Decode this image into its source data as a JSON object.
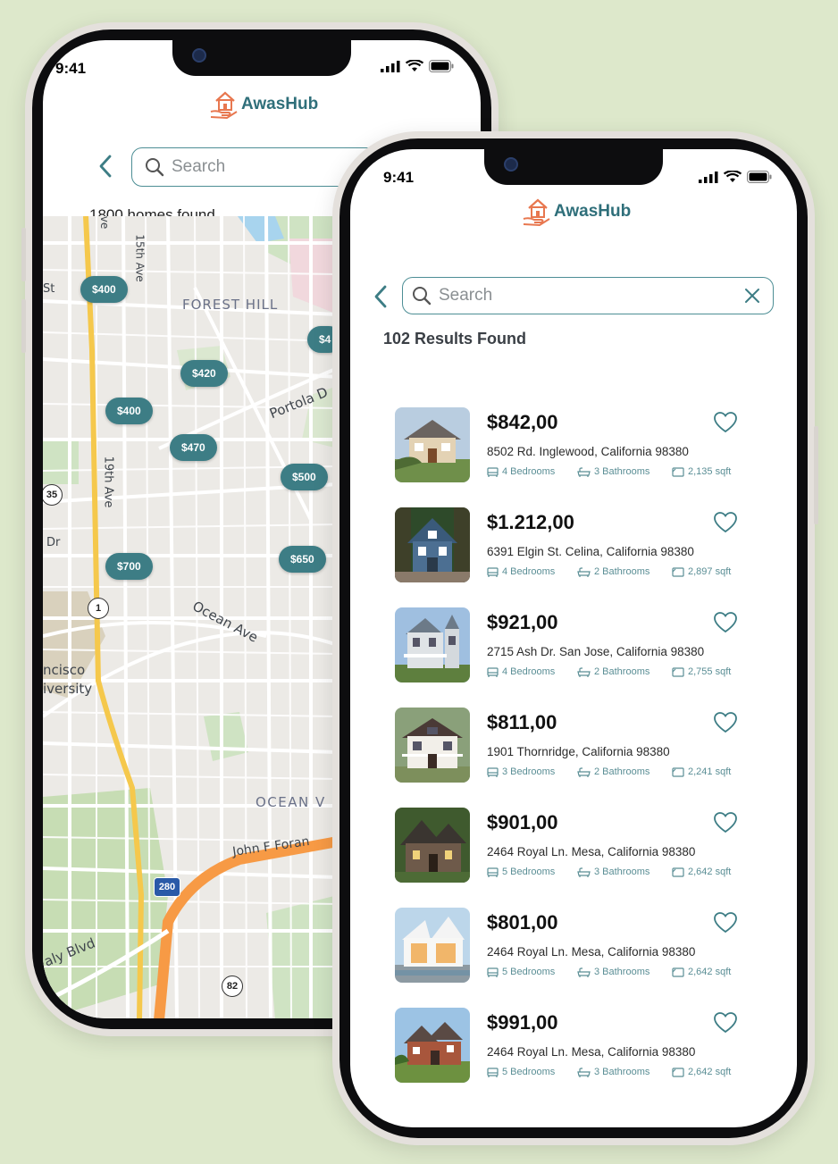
{
  "status": {
    "time": "9:41"
  },
  "brand": {
    "name": "AwasHub",
    "accent": "#e8774f",
    "primary": "#2f6f7a"
  },
  "map_screen": {
    "search_placeholder": "Search",
    "homes_found": "1800 homes found",
    "pins": [
      "$400",
      "$420",
      "$400",
      "$470",
      "$500",
      "$700",
      "$650",
      "$4"
    ],
    "labels": {
      "forest_hill": "FOREST HILL",
      "portola": "Portola D",
      "fifteenth_ave": "15th Ave",
      "nineteenth_ave": "19th Ave",
      "ocean_ave": "Ocean Ave",
      "ocean_v": "OCEAN V",
      "john_f_foran": "John F Foran",
      "francisco": "ncisco",
      "university": "iversity",
      "daly_blvd": "aly Blvd",
      "st": "St",
      "dr": "Dr",
      "ve": "ve"
    },
    "shields": [
      "35",
      "1",
      "280",
      "82"
    ]
  },
  "list_screen": {
    "search_placeholder": "Search",
    "results_found": "102 Results Found",
    "listings": [
      {
        "price": "$842,00",
        "address": "8502 Rd. Inglewood, California 98380",
        "bedrooms": "4 Bedrooms",
        "bathrooms": "3 Bathrooms",
        "area": "2,135 sqft",
        "image": "house-craftsman"
      },
      {
        "price": "$1.212,00",
        "address": "6391 Elgin St. Celina, California 98380",
        "bedrooms": "4 Bedrooms",
        "bathrooms": "2 Bathrooms",
        "area": "2,897 sqft",
        "image": "house-blue-cottage"
      },
      {
        "price": "$921,00",
        "address": "2715 Ash Dr. San Jose, California 98380",
        "bedrooms": "4 Bedrooms",
        "bathrooms": "2 Bathrooms",
        "area": "2,755 sqft",
        "image": "house-victorian"
      },
      {
        "price": "$811,00",
        "address": "1901 Thornridge, California 98380",
        "bedrooms": "3 Bedrooms",
        "bathrooms": "2 Bathrooms",
        "area": "2,241 sqft",
        "image": "house-white-porch"
      },
      {
        "price": "$901,00",
        "address": "2464 Royal Ln. Mesa, California 98380",
        "bedrooms": "5 Bedrooms",
        "bathrooms": "3 Bathrooms",
        "area": "2,642 sqft",
        "image": "house-stone-cottage"
      },
      {
        "price": "$801,00",
        "address": "2464 Royal Ln. Mesa, California 98380",
        "bedrooms": "5 Bedrooms",
        "bathrooms": "3 Bathrooms",
        "area": "2,642 sqft",
        "image": "house-modern"
      },
      {
        "price": "$991,00",
        "address": "2464 Royal Ln. Mesa, California 98380",
        "bedrooms": "5 Bedrooms",
        "bathrooms": "3 Bathrooms",
        "area": "2,642 sqft",
        "image": "house-brick"
      }
    ]
  }
}
